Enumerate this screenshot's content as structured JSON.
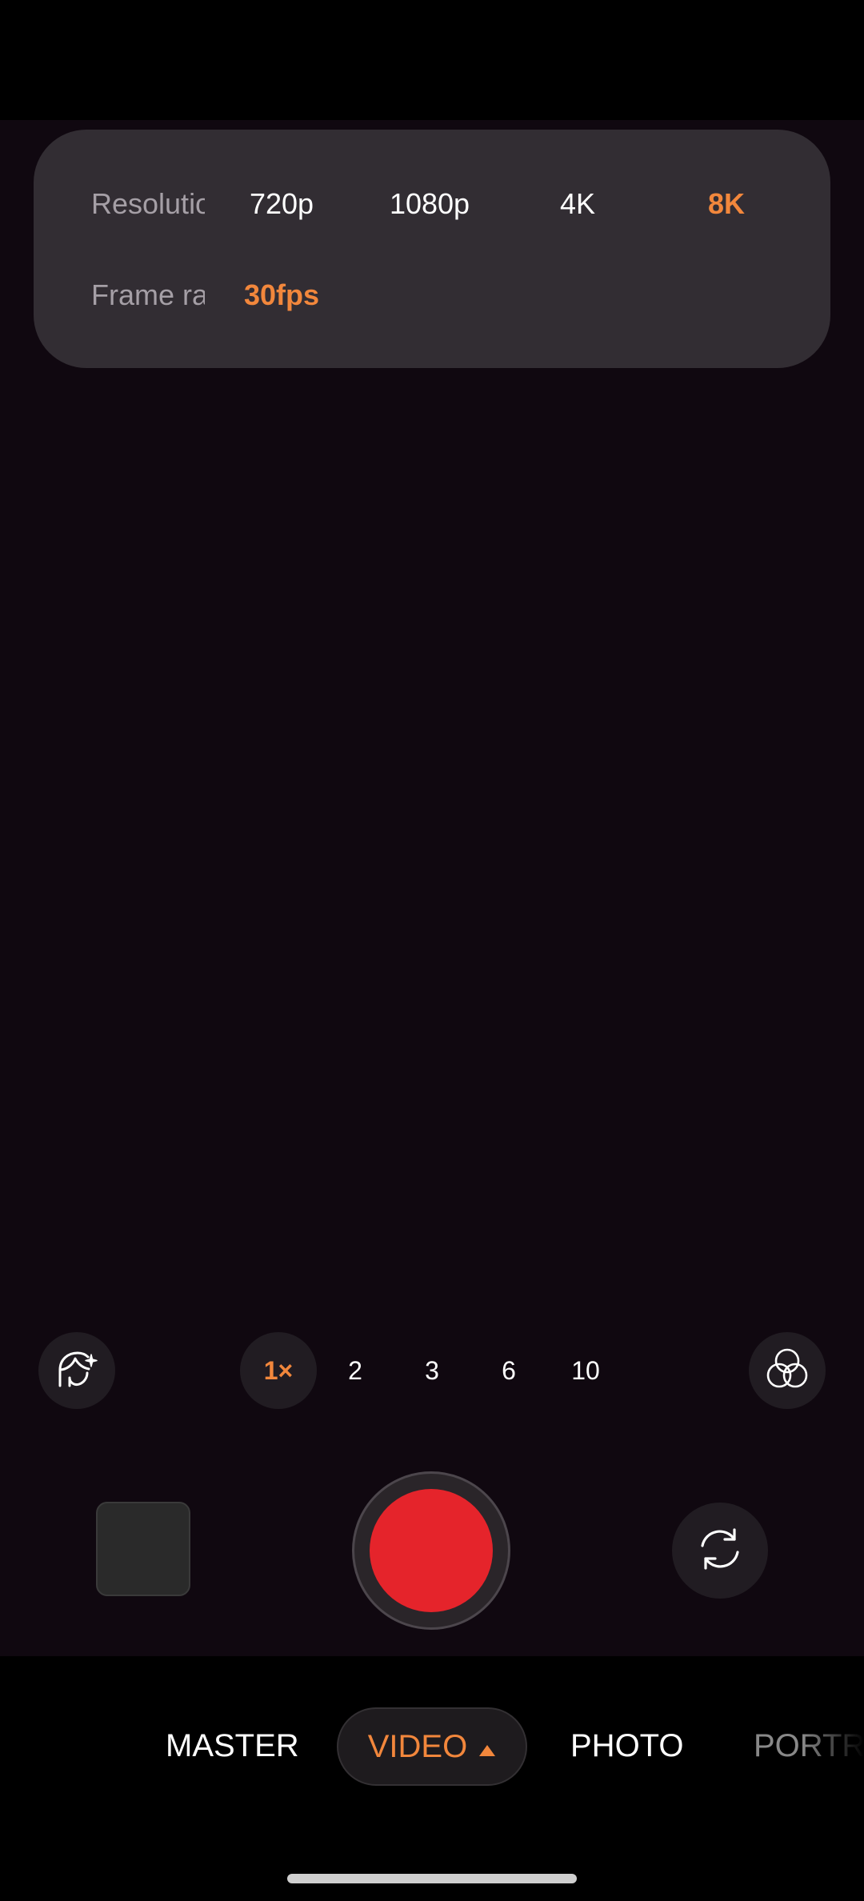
{
  "settings": {
    "resolution_label": "Resolution",
    "resolution_options": [
      "720p",
      "1080p",
      "4K",
      "8K"
    ],
    "resolution_selected": "8K",
    "framerate_label": "Frame rate",
    "framerate_options": [
      "30fps"
    ],
    "framerate_selected": "30fps"
  },
  "zoom": {
    "options": [
      "1×",
      "2",
      "3",
      "6",
      "10"
    ],
    "selected": "1×"
  },
  "icons": {
    "beauty": "face-sparkle-icon",
    "filters": "filter-circles-icon",
    "flip": "camera-flip-icon"
  },
  "modes": {
    "items": [
      "MASTER",
      "VIDEO",
      "PHOTO",
      "PORTRAIT"
    ],
    "selected": "VIDEO"
  },
  "colors": {
    "accent": "#f2873c",
    "record": "#e5242b"
  }
}
